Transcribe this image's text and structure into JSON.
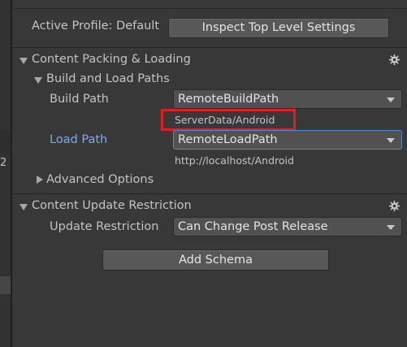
{
  "left_pane": {
    "edge_text": "2"
  },
  "header": {
    "active_profile_label": "Active Profile: Default",
    "inspect_button": "Inspect Top Level Settings"
  },
  "packing_section": {
    "title": "Content Packing & Loading",
    "subsection_title": "Build and Load Paths",
    "build_path_label": "Build Path",
    "build_path_value": "RemoteBuildPath",
    "build_path_resolved": "ServerData/Android",
    "load_path_label": "Load Path",
    "load_path_value": "RemoteLoadPath",
    "load_path_resolved": "http://localhost/Android",
    "advanced_label": "Advanced Options"
  },
  "update_section": {
    "title": "Content Update Restriction",
    "restriction_label": "Update Restriction",
    "restriction_value": "Can Change Post Release"
  },
  "footer": {
    "add_schema_button": "Add Schema"
  },
  "colors": {
    "background": "#383838",
    "accent_label": "#7fa9e8",
    "highlight_border": "#e0201e"
  },
  "icons": {
    "section_gear": "gear-icon",
    "foldout_expanded": "foldout-expanded-icon",
    "foldout_collapsed": "foldout-collapsed-icon",
    "dropdown_arrow": "dropdown-arrow-icon"
  }
}
